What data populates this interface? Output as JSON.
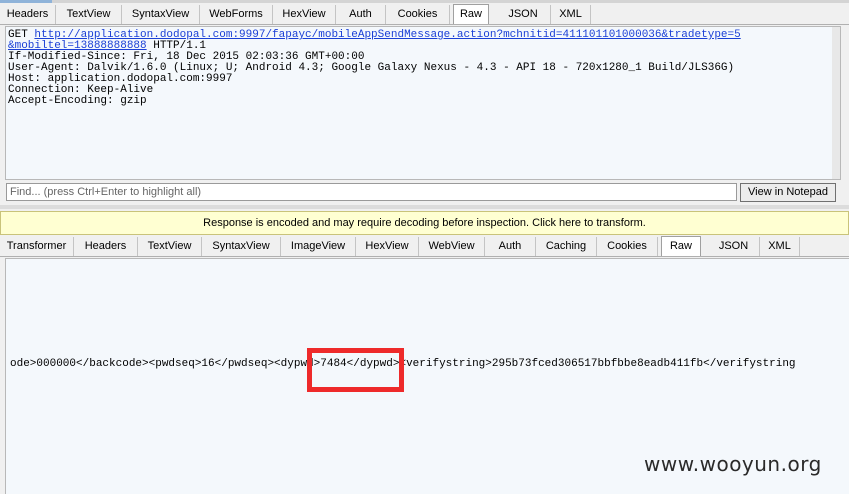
{
  "request_tabs": [
    "Headers",
    "TextView",
    "SyntaxView",
    "WebForms",
    "HexView",
    "Auth",
    "Cookies",
    "Raw",
    "JSON",
    "XML"
  ],
  "request_active_tab": "Raw",
  "request": {
    "line1_prefix": "GET ",
    "url_part1": "http://application.dodopal.com:9997/fapayc/mobileAppSendMessage.action?mchnitid=411101101000036&tradetype=5",
    "url_part2": "&mobiltel=13888888888",
    "line2_suffix": " HTTP/1.1",
    "headers": [
      "If-Modified-Since: Fri, 18 Dec 2015 02:03:36 GMT+00:00",
      "User-Agent: Dalvik/1.6.0 (Linux; U; Android 4.3; Google Galaxy Nexus - 4.3 - API 18 - 720x1280_1 Build/JLS36G)",
      "Host: application.dodopal.com:9997",
      "Connection: Keep-Alive",
      "Accept-Encoding: gzip"
    ]
  },
  "find": {
    "placeholder": "Find... (press Ctrl+Enter to highlight all)",
    "button": "View in Notepad"
  },
  "banner": "Response is encoded and may require decoding before inspection. Click here to transform.",
  "response_tabs": [
    "Transformer",
    "Headers",
    "TextView",
    "SyntaxView",
    "ImageView",
    "HexView",
    "WebView",
    "Auth",
    "Caching",
    "Cookies",
    "Raw",
    "JSON",
    "XML"
  ],
  "response_active_tab": "Raw",
  "response_body": "ode>000000</backcode><pwdseq>16</pwdseq><dypwd>7484</dypwd><verifystring>295b73fced306517bbfbbe8eadb411fb</verifystring",
  "watermark": "www.wooyun.org",
  "colors": {
    "highlight_box": "#ee2a2a",
    "link": "#1a3fd6",
    "banner_bg": "#ffffd2"
  }
}
